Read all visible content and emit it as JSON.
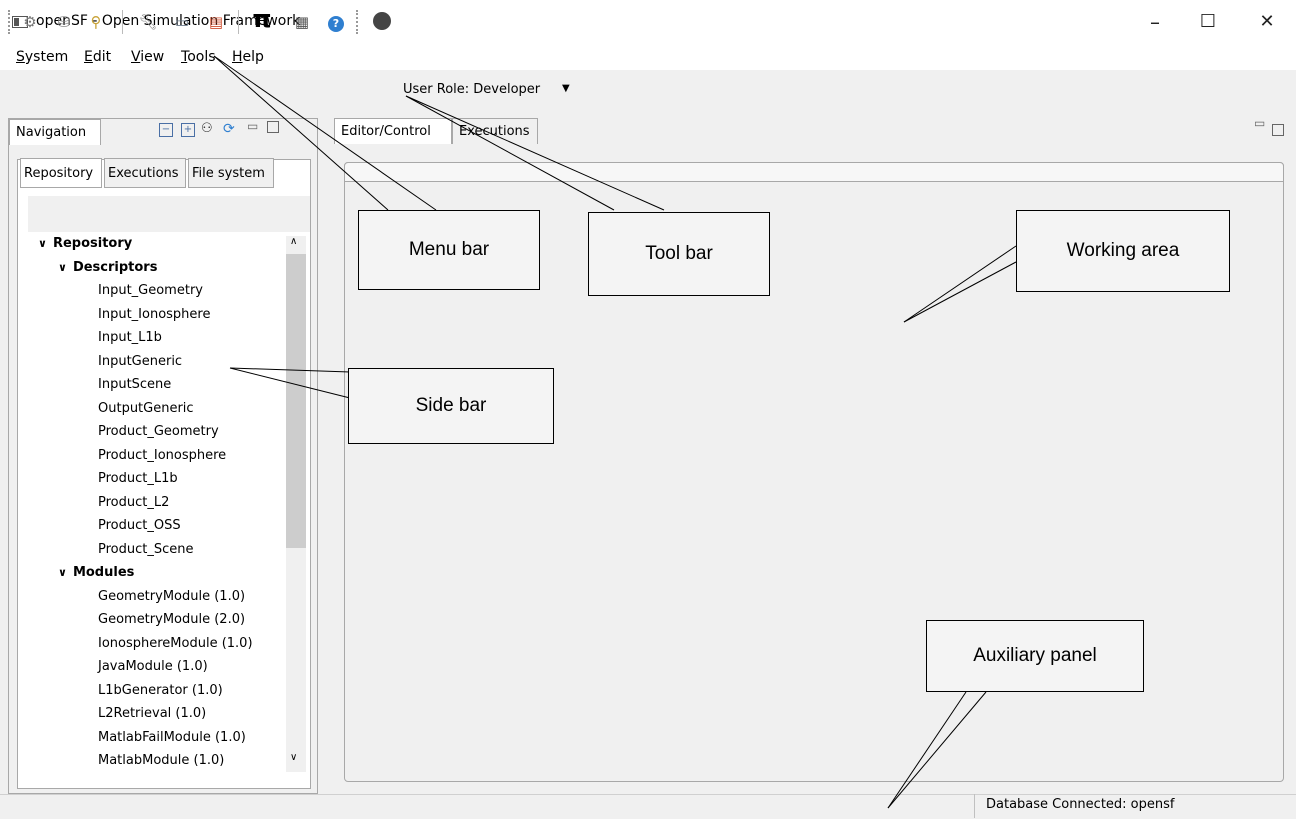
{
  "window": {
    "title": "openSF - Open Simulation Framework",
    "minimize": "–",
    "maximize": "☐",
    "close": "✕"
  },
  "menu": [
    {
      "name": "menu-system",
      "label": "System",
      "u": "S"
    },
    {
      "name": "menu-edit",
      "label": "Edit",
      "u": "E"
    },
    {
      "name": "menu-view",
      "label": "View",
      "u": "V"
    },
    {
      "name": "menu-tools",
      "label": "Tools",
      "u": "T"
    },
    {
      "name": "menu-help",
      "label": "Help",
      "u": "H"
    }
  ],
  "toolbar": {
    "icons": [
      "gear-icon",
      "database-icon",
      "probe-icon",
      "wrench-icon",
      "book-icon",
      "document-icon",
      "pi-icon",
      "chip-icon",
      "help-icon",
      "user-icon"
    ],
    "user_role": "User Role: Developer",
    "dropdown": "▼"
  },
  "navigation": {
    "tab": "Navigation",
    "sub_tabs": [
      "Repository",
      "Executions",
      "File system"
    ],
    "tree": [
      {
        "label": "Repository",
        "level": 0,
        "bold": true,
        "expander": "∨"
      },
      {
        "label": "Descriptors",
        "level": 1,
        "bold": true,
        "expander": "∨"
      },
      {
        "label": "Input_Geometry",
        "level": 2
      },
      {
        "label": "Input_Ionosphere",
        "level": 2
      },
      {
        "label": "Input_L1b",
        "level": 2
      },
      {
        "label": "InputGeneric",
        "level": 2
      },
      {
        "label": "InputScene",
        "level": 2
      },
      {
        "label": "OutputGeneric",
        "level": 2
      },
      {
        "label": "Product_Geometry",
        "level": 2
      },
      {
        "label": "Product_Ionosphere",
        "level": 2
      },
      {
        "label": "Product_L1b",
        "level": 2
      },
      {
        "label": "Product_L2",
        "level": 2
      },
      {
        "label": "Product_OSS",
        "level": 2
      },
      {
        "label": "Product_Scene",
        "level": 2
      },
      {
        "label": "Modules",
        "level": 1,
        "bold": true,
        "expander": "∨"
      },
      {
        "label": "GeometryModule (1.0)",
        "level": 2
      },
      {
        "label": "GeometryModule (2.0)",
        "level": 2
      },
      {
        "label": "IonosphereModule (1.0)",
        "level": 2
      },
      {
        "label": "JavaModule (1.0)",
        "level": 2
      },
      {
        "label": "L1bGenerator (1.0)",
        "level": 2
      },
      {
        "label": "L2Retrieval (1.0)",
        "level": 2
      },
      {
        "label": "MatlabFailModule (1.0)",
        "level": 2
      },
      {
        "label": "MatlabModule (1.0)",
        "level": 2
      }
    ]
  },
  "editor": {
    "tabs": [
      "Editor/Control",
      "Executions"
    ]
  },
  "status": {
    "text": "Database Connected: opensf"
  },
  "annotations": {
    "menu_bar": "Menu bar",
    "tool_bar": "Tool bar",
    "working_area": "Working area",
    "side_bar": "Side bar",
    "auxiliary_panel": "Auxiliary panel"
  }
}
